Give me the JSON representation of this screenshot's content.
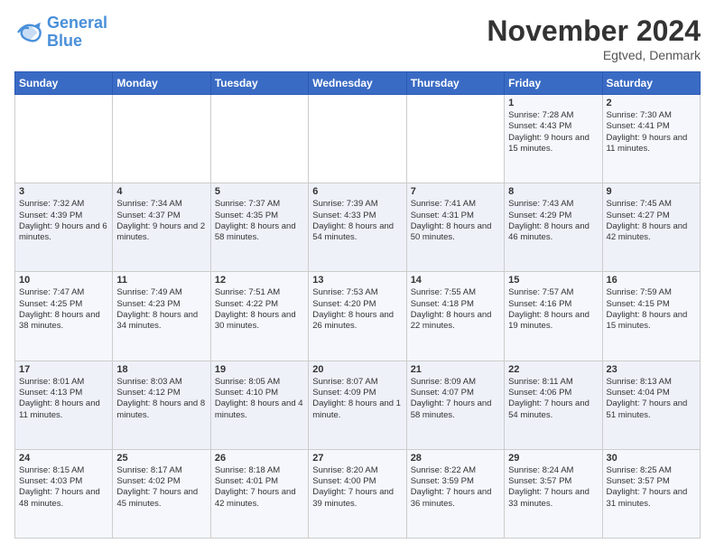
{
  "logo": {
    "line1": "General",
    "line2": "Blue"
  },
  "header": {
    "month": "November 2024",
    "location": "Egtved, Denmark"
  },
  "weekdays": [
    "Sunday",
    "Monday",
    "Tuesday",
    "Wednesday",
    "Thursday",
    "Friday",
    "Saturday"
  ],
  "weeks": [
    [
      {
        "day": "",
        "info": ""
      },
      {
        "day": "",
        "info": ""
      },
      {
        "day": "",
        "info": ""
      },
      {
        "day": "",
        "info": ""
      },
      {
        "day": "",
        "info": ""
      },
      {
        "day": "1",
        "info": "Sunrise: 7:28 AM\nSunset: 4:43 PM\nDaylight: 9 hours and 15 minutes."
      },
      {
        "day": "2",
        "info": "Sunrise: 7:30 AM\nSunset: 4:41 PM\nDaylight: 9 hours and 11 minutes."
      }
    ],
    [
      {
        "day": "3",
        "info": "Sunrise: 7:32 AM\nSunset: 4:39 PM\nDaylight: 9 hours and 6 minutes."
      },
      {
        "day": "4",
        "info": "Sunrise: 7:34 AM\nSunset: 4:37 PM\nDaylight: 9 hours and 2 minutes."
      },
      {
        "day": "5",
        "info": "Sunrise: 7:37 AM\nSunset: 4:35 PM\nDaylight: 8 hours and 58 minutes."
      },
      {
        "day": "6",
        "info": "Sunrise: 7:39 AM\nSunset: 4:33 PM\nDaylight: 8 hours and 54 minutes."
      },
      {
        "day": "7",
        "info": "Sunrise: 7:41 AM\nSunset: 4:31 PM\nDaylight: 8 hours and 50 minutes."
      },
      {
        "day": "8",
        "info": "Sunrise: 7:43 AM\nSunset: 4:29 PM\nDaylight: 8 hours and 46 minutes."
      },
      {
        "day": "9",
        "info": "Sunrise: 7:45 AM\nSunset: 4:27 PM\nDaylight: 8 hours and 42 minutes."
      }
    ],
    [
      {
        "day": "10",
        "info": "Sunrise: 7:47 AM\nSunset: 4:25 PM\nDaylight: 8 hours and 38 minutes."
      },
      {
        "day": "11",
        "info": "Sunrise: 7:49 AM\nSunset: 4:23 PM\nDaylight: 8 hours and 34 minutes."
      },
      {
        "day": "12",
        "info": "Sunrise: 7:51 AM\nSunset: 4:22 PM\nDaylight: 8 hours and 30 minutes."
      },
      {
        "day": "13",
        "info": "Sunrise: 7:53 AM\nSunset: 4:20 PM\nDaylight: 8 hours and 26 minutes."
      },
      {
        "day": "14",
        "info": "Sunrise: 7:55 AM\nSunset: 4:18 PM\nDaylight: 8 hours and 22 minutes."
      },
      {
        "day": "15",
        "info": "Sunrise: 7:57 AM\nSunset: 4:16 PM\nDaylight: 8 hours and 19 minutes."
      },
      {
        "day": "16",
        "info": "Sunrise: 7:59 AM\nSunset: 4:15 PM\nDaylight: 8 hours and 15 minutes."
      }
    ],
    [
      {
        "day": "17",
        "info": "Sunrise: 8:01 AM\nSunset: 4:13 PM\nDaylight: 8 hours and 11 minutes."
      },
      {
        "day": "18",
        "info": "Sunrise: 8:03 AM\nSunset: 4:12 PM\nDaylight: 8 hours and 8 minutes."
      },
      {
        "day": "19",
        "info": "Sunrise: 8:05 AM\nSunset: 4:10 PM\nDaylight: 8 hours and 4 minutes."
      },
      {
        "day": "20",
        "info": "Sunrise: 8:07 AM\nSunset: 4:09 PM\nDaylight: 8 hours and 1 minute."
      },
      {
        "day": "21",
        "info": "Sunrise: 8:09 AM\nSunset: 4:07 PM\nDaylight: 7 hours and 58 minutes."
      },
      {
        "day": "22",
        "info": "Sunrise: 8:11 AM\nSunset: 4:06 PM\nDaylight: 7 hours and 54 minutes."
      },
      {
        "day": "23",
        "info": "Sunrise: 8:13 AM\nSunset: 4:04 PM\nDaylight: 7 hours and 51 minutes."
      }
    ],
    [
      {
        "day": "24",
        "info": "Sunrise: 8:15 AM\nSunset: 4:03 PM\nDaylight: 7 hours and 48 minutes."
      },
      {
        "day": "25",
        "info": "Sunrise: 8:17 AM\nSunset: 4:02 PM\nDaylight: 7 hours and 45 minutes."
      },
      {
        "day": "26",
        "info": "Sunrise: 8:18 AM\nSunset: 4:01 PM\nDaylight: 7 hours and 42 minutes."
      },
      {
        "day": "27",
        "info": "Sunrise: 8:20 AM\nSunset: 4:00 PM\nDaylight: 7 hours and 39 minutes."
      },
      {
        "day": "28",
        "info": "Sunrise: 8:22 AM\nSunset: 3:59 PM\nDaylight: 7 hours and 36 minutes."
      },
      {
        "day": "29",
        "info": "Sunrise: 8:24 AM\nSunset: 3:57 PM\nDaylight: 7 hours and 33 minutes."
      },
      {
        "day": "30",
        "info": "Sunrise: 8:25 AM\nSunset: 3:57 PM\nDaylight: 7 hours and 31 minutes."
      }
    ]
  ]
}
